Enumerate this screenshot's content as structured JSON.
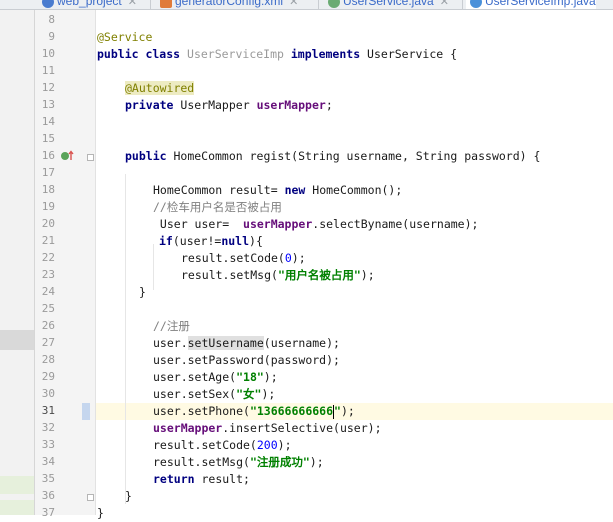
{
  "tabs": [
    {
      "label": "web_project",
      "icon": "module-icon",
      "color": "#4a7ccf"
    },
    {
      "label": "generatorConfig.xml",
      "icon": "xml-file-icon",
      "color": "#e07b39"
    },
    {
      "label": "UserService.java",
      "icon": "interface-icon",
      "color": "#6aab73"
    },
    {
      "label": "UserServiceImp.java",
      "icon": "class-icon",
      "color": "#4a90d9"
    }
  ],
  "line_numbers": [
    "8",
    "9",
    "10",
    "11",
    "12",
    "13",
    "14",
    "15",
    "16",
    "17",
    "18",
    "19",
    "20",
    "21",
    "22",
    "23",
    "24",
    "25",
    "26",
    "27",
    "28",
    "29",
    "30",
    "31",
    "32",
    "33",
    "34",
    "35",
    "36",
    "37"
  ],
  "current_line": "31",
  "code": {
    "l9_ann": "@Service",
    "l10_kw1": "public class ",
    "l10_cls": "UserServiceImp",
    "l10_kw2": " implements ",
    "l10_rest": "UserService {",
    "l12_ann": "@Autowired",
    "l13_kw": "private ",
    "l13_type": "UserMapper ",
    "l13_fld": "userMapper",
    "l13_end": ";",
    "l16_kw": "public ",
    "l16_rest": "HomeCommon regist(String username, String password) {",
    "l18_a": "HomeCommon result= ",
    "l18_kw": "new ",
    "l18_b": "HomeCommon();",
    "l19_cmt": "//检车用户名是否被占用",
    "l20_a": " User user=  ",
    "l20_fld": "userMapper",
    "l20_b": ".selectByname(username);",
    "l21_kw1": "if",
    "l21_a": "(user!=",
    "l21_kw2": "null",
    "l21_b": "){",
    "l22_a": "result.setCode(",
    "l22_num": "0",
    "l22_b": ");",
    "l23_a": "result.setMsg(",
    "l23_str": "\"用户名被占用\"",
    "l23_b": ");",
    "l24": "}",
    "l26_cmt": "//注册",
    "l27_a": "user.",
    "l27_hl": "setUsername",
    "l27_b": "(username);",
    "l28": "user.setPassword(password);",
    "l29_a": "user.setAge(",
    "l29_str": "\"18\"",
    "l29_b": ");",
    "l30_a": "user.setSex(",
    "l30_str": "\"女\"",
    "l30_b": ");",
    "l31_a": "user.setPhone(",
    "l31_str1": "\"13666666666",
    "l31_str2": "\"",
    "l31_b": ");",
    "l32_fld": "userMapper",
    "l32_b": ".insertSelective(user);",
    "l33_a": "result.setCode(",
    "l33_num": "200",
    "l33_b": ");",
    "l34_a": "result.setMsg(",
    "l34_str": "\"注册成功\"",
    "l34_b": ");",
    "l35_kw": "return ",
    "l35_b": "result;",
    "l36": "}",
    "l37": "}"
  }
}
